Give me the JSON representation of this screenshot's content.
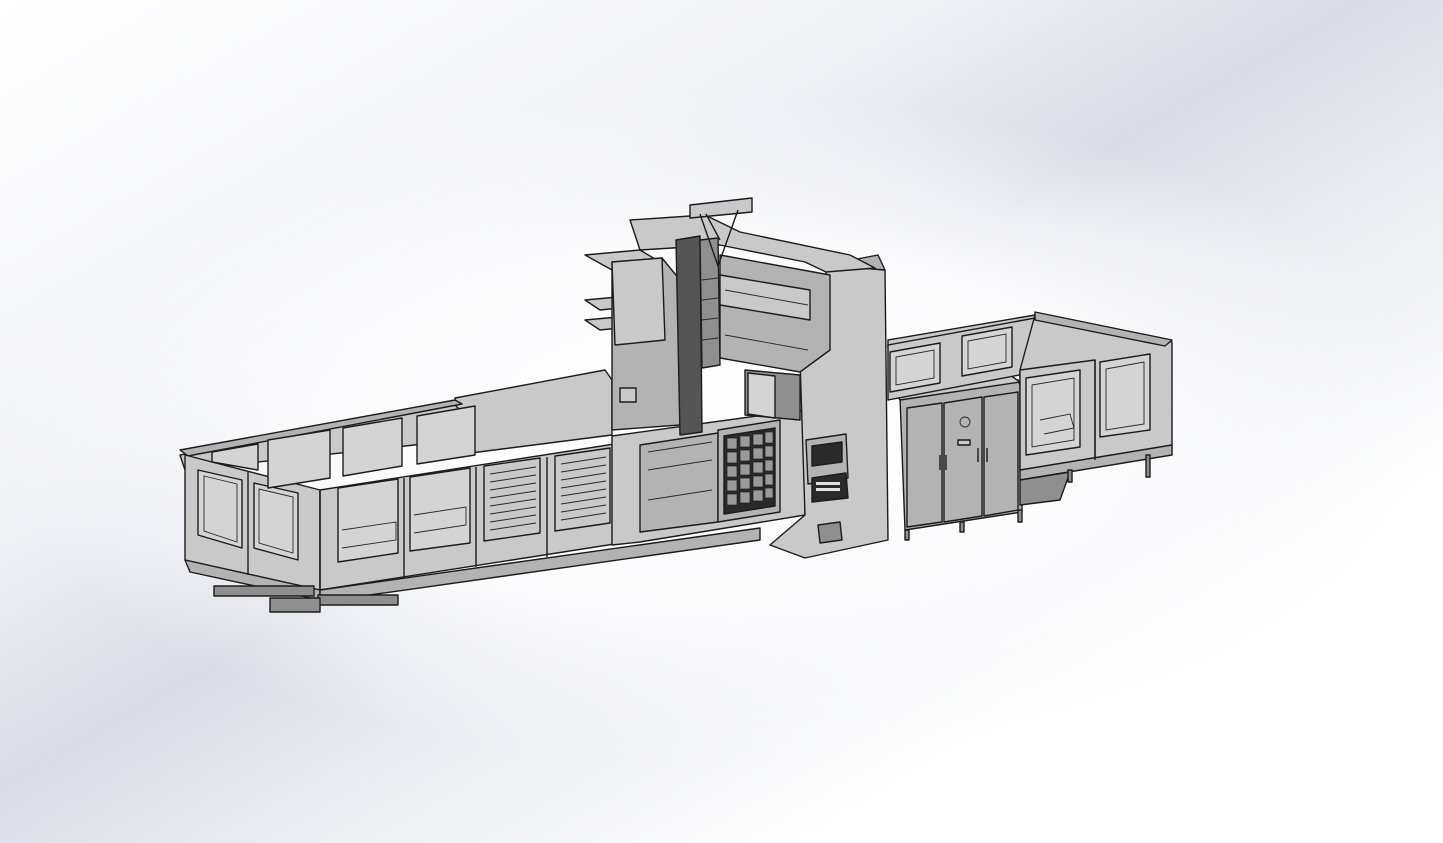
{
  "scene": {
    "background_top": "#ffffff",
    "background_band": "#d9dce6",
    "machine_body_color": "#c9c9c9",
    "machine_shadow_color": "#8f8f8f",
    "edge_color": "#1c1c1c"
  }
}
